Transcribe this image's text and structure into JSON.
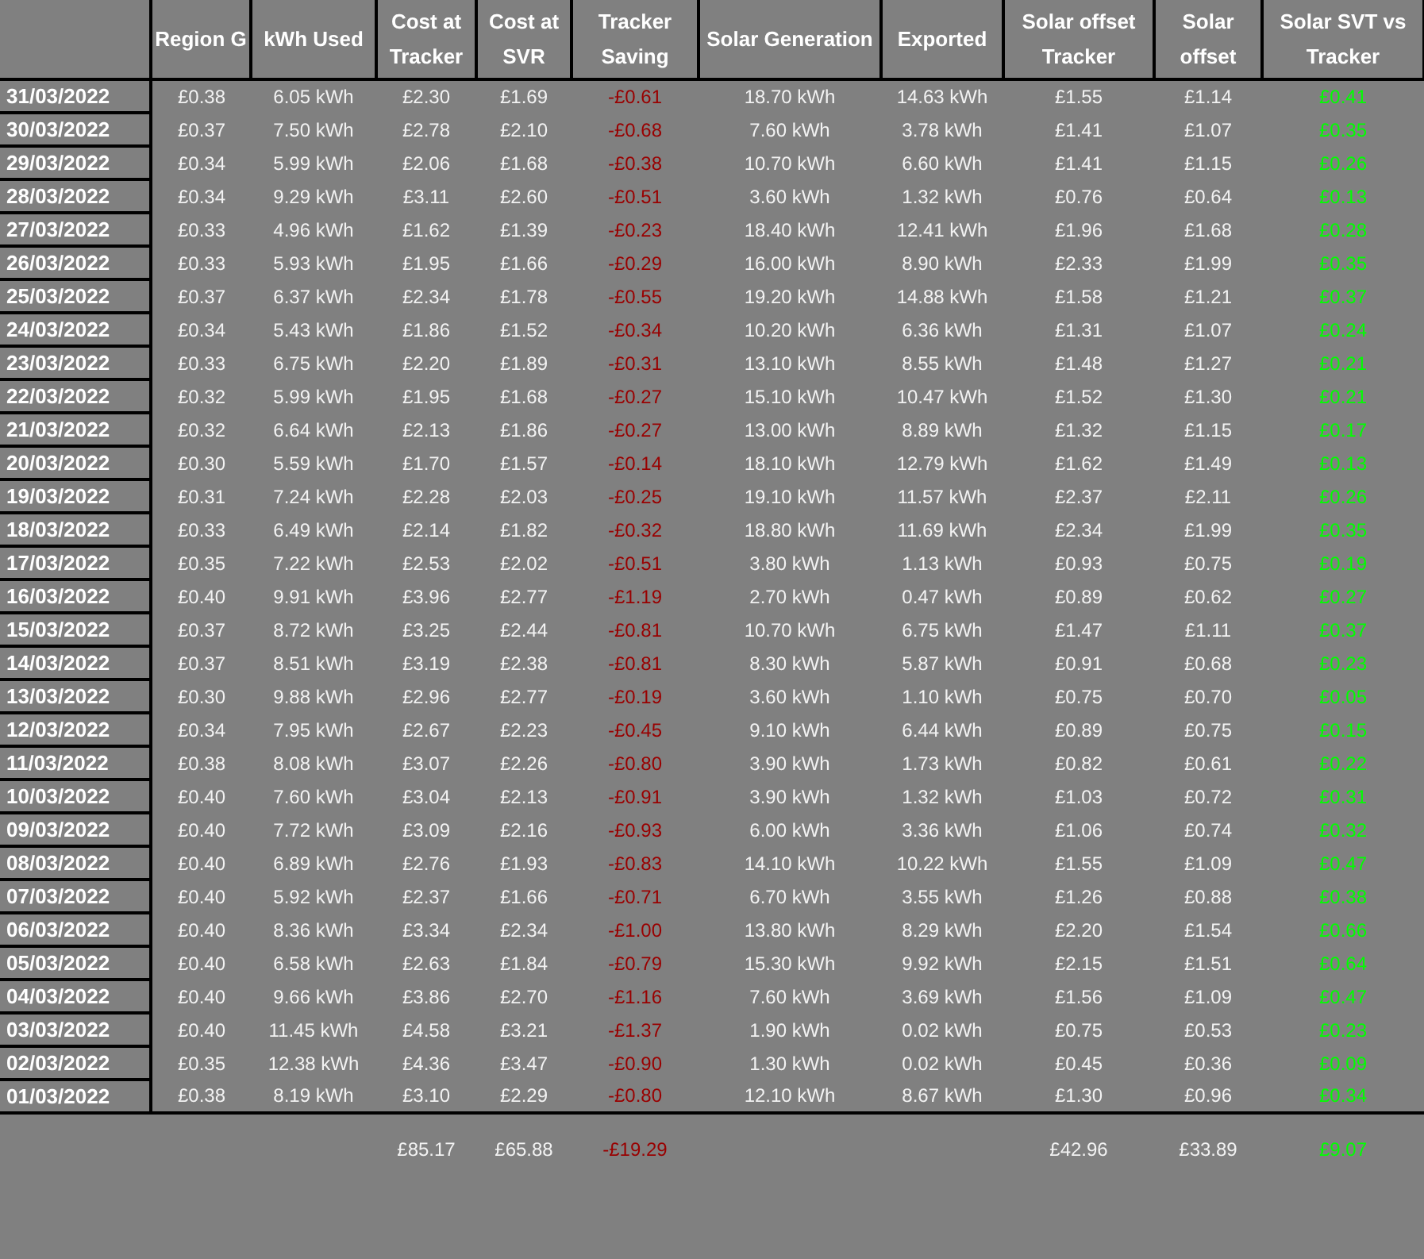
{
  "columns": [
    {
      "color": "#ffffff"
    },
    {
      "heading": "Region G",
      "color": "#f2f2f2"
    },
    {
      "heading": "kWh Used",
      "color": "#f2f2f2"
    },
    {
      "heading": "Cost at Tracker",
      "color": "#f2f2f2",
      "total": "£85.17"
    },
    {
      "heading": "Cost at SVR",
      "color": "#f2f2f2",
      "total": "£65.88"
    },
    {
      "heading": "Tracker Saving",
      "color": "#990000",
      "total": "-£19.29"
    },
    {
      "heading": "Solar Generation",
      "color": "#f2f2f2"
    },
    {
      "heading": "Exported",
      "color": "#f2f2f2"
    },
    {
      "heading": "Solar offset Tracker",
      "color": "#f2f2f2",
      "total": "£42.96"
    },
    {
      "heading": "Solar offset",
      "color": "#f2f2f2",
      "total": "£33.89"
    },
    {
      "heading": "Solar SVT vs Tracker",
      "color": "#00ff00",
      "total": "£9.07"
    }
  ],
  "rows": [
    [
      "31/03/2022",
      "£0.38",
      "6.05 kWh",
      "£2.30",
      "£1.69",
      "-£0.61",
      "18.70 kWh",
      "14.63 kWh",
      "£1.55",
      "£1.14",
      "£0.41"
    ],
    [
      "30/03/2022",
      "£0.37",
      "7.50 kWh",
      "£2.78",
      "£2.10",
      "-£0.68",
      "7.60 kWh",
      "3.78 kWh",
      "£1.41",
      "£1.07",
      "£0.35"
    ],
    [
      "29/03/2022",
      "£0.34",
      "5.99 kWh",
      "£2.06",
      "£1.68",
      "-£0.38",
      "10.70 kWh",
      "6.60 kWh",
      "£1.41",
      "£1.15",
      "£0.26"
    ],
    [
      "28/03/2022",
      "£0.34",
      "9.29 kWh",
      "£3.11",
      "£2.60",
      "-£0.51",
      "3.60 kWh",
      "1.32 kWh",
      "£0.76",
      "£0.64",
      "£0.13"
    ],
    [
      "27/03/2022",
      "£0.33",
      "4.96 kWh",
      "£1.62",
      "£1.39",
      "-£0.23",
      "18.40 kWh",
      "12.41 kWh",
      "£1.96",
      "£1.68",
      "£0.28"
    ],
    [
      "26/03/2022",
      "£0.33",
      "5.93 kWh",
      "£1.95",
      "£1.66",
      "-£0.29",
      "16.00 kWh",
      "8.90 kWh",
      "£2.33",
      "£1.99",
      "£0.35"
    ],
    [
      "25/03/2022",
      "£0.37",
      "6.37 kWh",
      "£2.34",
      "£1.78",
      "-£0.55",
      "19.20 kWh",
      "14.88 kWh",
      "£1.58",
      "£1.21",
      "£0.37"
    ],
    [
      "24/03/2022",
      "£0.34",
      "5.43 kWh",
      "£1.86",
      "£1.52",
      "-£0.34",
      "10.20 kWh",
      "6.36 kWh",
      "£1.31",
      "£1.07",
      "£0.24"
    ],
    [
      "23/03/2022",
      "£0.33",
      "6.75 kWh",
      "£2.20",
      "£1.89",
      "-£0.31",
      "13.10 kWh",
      "8.55 kWh",
      "£1.48",
      "£1.27",
      "£0.21"
    ],
    [
      "22/03/2022",
      "£0.32",
      "5.99 kWh",
      "£1.95",
      "£1.68",
      "-£0.27",
      "15.10 kWh",
      "10.47 kWh",
      "£1.52",
      "£1.30",
      "£0.21"
    ],
    [
      "21/03/2022",
      "£0.32",
      "6.64 kWh",
      "£2.13",
      "£1.86",
      "-£0.27",
      "13.00 kWh",
      "8.89 kWh",
      "£1.32",
      "£1.15",
      "£0.17"
    ],
    [
      "20/03/2022",
      "£0.30",
      "5.59 kWh",
      "£1.70",
      "£1.57",
      "-£0.14",
      "18.10 kWh",
      "12.79 kWh",
      "£1.62",
      "£1.49",
      "£0.13"
    ],
    [
      "19/03/2022",
      "£0.31",
      "7.24 kWh",
      "£2.28",
      "£2.03",
      "-£0.25",
      "19.10 kWh",
      "11.57 kWh",
      "£2.37",
      "£2.11",
      "£0.26"
    ],
    [
      "18/03/2022",
      "£0.33",
      "6.49 kWh",
      "£2.14",
      "£1.82",
      "-£0.32",
      "18.80 kWh",
      "11.69 kWh",
      "£2.34",
      "£1.99",
      "£0.35"
    ],
    [
      "17/03/2022",
      "£0.35",
      "7.22 kWh",
      "£2.53",
      "£2.02",
      "-£0.51",
      "3.80 kWh",
      "1.13 kWh",
      "£0.93",
      "£0.75",
      "£0.19"
    ],
    [
      "16/03/2022",
      "£0.40",
      "9.91 kWh",
      "£3.96",
      "£2.77",
      "-£1.19",
      "2.70 kWh",
      "0.47 kWh",
      "£0.89",
      "£0.62",
      "£0.27"
    ],
    [
      "15/03/2022",
      "£0.37",
      "8.72 kWh",
      "£3.25",
      "£2.44",
      "-£0.81",
      "10.70 kWh",
      "6.75 kWh",
      "£1.47",
      "£1.11",
      "£0.37"
    ],
    [
      "14/03/2022",
      "£0.37",
      "8.51 kWh",
      "£3.19",
      "£2.38",
      "-£0.81",
      "8.30 kWh",
      "5.87 kWh",
      "£0.91",
      "£0.68",
      "£0.23"
    ],
    [
      "13/03/2022",
      "£0.30",
      "9.88 kWh",
      "£2.96",
      "£2.77",
      "-£0.19",
      "3.60 kWh",
      "1.10 kWh",
      "£0.75",
      "£0.70",
      "£0.05"
    ],
    [
      "12/03/2022",
      "£0.34",
      "7.95 kWh",
      "£2.67",
      "£2.23",
      "-£0.45",
      "9.10 kWh",
      "6.44 kWh",
      "£0.89",
      "£0.75",
      "£0.15"
    ],
    [
      "11/03/2022",
      "£0.38",
      "8.08 kWh",
      "£3.07",
      "£2.26",
      "-£0.80",
      "3.90 kWh",
      "1.73 kWh",
      "£0.82",
      "£0.61",
      "£0.22"
    ],
    [
      "10/03/2022",
      "£0.40",
      "7.60 kWh",
      "£3.04",
      "£2.13",
      "-£0.91",
      "3.90 kWh",
      "1.32 kWh",
      "£1.03",
      "£0.72",
      "£0.31"
    ],
    [
      "09/03/2022",
      "£0.40",
      "7.72 kWh",
      "£3.09",
      "£2.16",
      "-£0.93",
      "6.00 kWh",
      "3.36 kWh",
      "£1.06",
      "£0.74",
      "£0.32"
    ],
    [
      "08/03/2022",
      "£0.40",
      "6.89 kWh",
      "£2.76",
      "£1.93",
      "-£0.83",
      "14.10 kWh",
      "10.22 kWh",
      "£1.55",
      "£1.09",
      "£0.47"
    ],
    [
      "07/03/2022",
      "£0.40",
      "5.92 kWh",
      "£2.37",
      "£1.66",
      "-£0.71",
      "6.70 kWh",
      "3.55 kWh",
      "£1.26",
      "£0.88",
      "£0.38"
    ],
    [
      "06/03/2022",
      "£0.40",
      "8.36 kWh",
      "£3.34",
      "£2.34",
      "-£1.00",
      "13.80 kWh",
      "8.29 kWh",
      "£2.20",
      "£1.54",
      "£0.66"
    ],
    [
      "05/03/2022",
      "£0.40",
      "6.58 kWh",
      "£2.63",
      "£1.84",
      "-£0.79",
      "15.30 kWh",
      "9.92 kWh",
      "£2.15",
      "£1.51",
      "£0.64"
    ],
    [
      "04/03/2022",
      "£0.40",
      "9.66 kWh",
      "£3.86",
      "£2.70",
      "-£1.16",
      "7.60 kWh",
      "3.69 kWh",
      "£1.56",
      "£1.09",
      "£0.47"
    ],
    [
      "03/03/2022",
      "£0.40",
      "11.45 kWh",
      "£4.58",
      "£3.21",
      "-£1.37",
      "1.90 kWh",
      "0.02 kWh",
      "£0.75",
      "£0.53",
      "£0.23"
    ],
    [
      "02/03/2022",
      "£0.35",
      "12.38 kWh",
      "£4.36",
      "£3.47",
      "-£0.90",
      "1.30 kWh",
      "0.02 kWh",
      "£0.45",
      "£0.36",
      "£0.09"
    ],
    [
      "01/03/2022",
      "£0.38",
      "8.19 kWh",
      "£3.10",
      "£2.29",
      "-£0.80",
      "12.10 kWh",
      "8.67 kWh",
      "£1.30",
      "£0.96",
      "£0.34"
    ]
  ]
}
